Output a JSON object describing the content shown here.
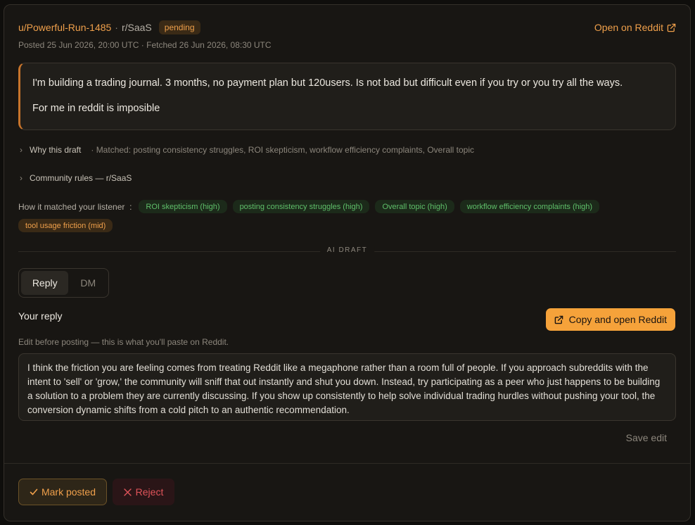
{
  "post": {
    "author": "u/Powerful-Run-1485",
    "separator": "·",
    "subreddit": "r/SaaS",
    "status": "pending",
    "meta": "Posted 25 Jun 2026, 20:00 UTC · Fetched 26 Jun 2026, 08:30 UTC",
    "open_label": "Open on Reddit",
    "body": [
      "I'm building a trading journal. 3 months, no payment plan but 120users. Is not bad but difficult even if you try or you try all the ways.",
      "For me in reddit is imposible"
    ]
  },
  "why": {
    "label": "Why this draft",
    "meta": "· Matched: posting consistency struggles, ROI skepticism, workflow efficiency complaints, Overall topic"
  },
  "rules": {
    "label": "Community rules — r/SaaS"
  },
  "listener": {
    "label": "How it matched your listener",
    "colon": ":",
    "tags": [
      {
        "text": "ROI skepticism (high)",
        "level": "high"
      },
      {
        "text": "posting consistency struggles (high)",
        "level": "high"
      },
      {
        "text": "Overall topic (high)",
        "level": "high"
      },
      {
        "text": "workflow efficiency complaints (high)",
        "level": "high"
      },
      {
        "text": "tool usage friction (mid)",
        "level": "mid"
      }
    ]
  },
  "draft": {
    "divider_label": "AI DRAFT",
    "tabs": {
      "reply": "Reply",
      "dm": "DM"
    },
    "title": "Your reply",
    "copy_label": "Copy and open Reddit",
    "hint": "Edit before posting — this is what you'll paste on Reddit.",
    "text": "I think the friction you are feeling comes from treating Reddit like a megaphone rather than a room full of people. If you approach subreddits with the intent to 'sell' or 'grow,' the community will sniff that out instantly and shut you down. Instead, try participating as a peer who just happens to be building a solution to a problem they are currently discussing. If you show up consistently to help solve individual trading hurdles without pushing your tool, the conversion dynamic shifts from a cold pitch to an authentic recommendation.",
    "save_label": "Save edit"
  },
  "actions": {
    "mark_label": "Mark posted",
    "reject_label": "Reject"
  },
  "icons": {
    "external": "external-link-icon",
    "chevron": "chevron-right-icon",
    "check": "check-icon",
    "close": "close-icon"
  }
}
